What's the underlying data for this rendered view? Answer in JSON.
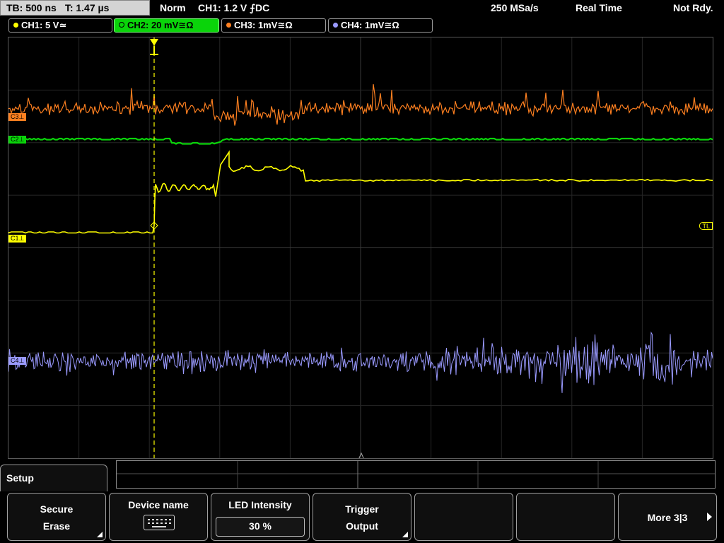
{
  "status_bar": {
    "timebase": "TB: 500 ns",
    "trigger_time": "T: 1.47 µs",
    "trigger_mode": "Norm",
    "trigger_info": "CH1: 1.2 V ⨍DC",
    "sample_rate": "250 MSa/s",
    "acq_mode": "Real Time",
    "state": "Not Rdy."
  },
  "channels": [
    {
      "label": "CH1: 5 V≃",
      "color": "#ffff00"
    },
    {
      "label": "CH2: 20 mV≅Ω",
      "color": "#0ad40a",
      "active": true
    },
    {
      "label": "CH3: 1mV≅Ω",
      "color": "#ff8020"
    },
    {
      "label": "CH4: 1mV≅Ω",
      "color": "#9a9aff"
    }
  ],
  "markers": {
    "c3": "C3⊥",
    "c2": "C2⊥",
    "c1": "C1⊥",
    "c4": "C4⊥",
    "trigger_level": "TL"
  },
  "menu": {
    "title": "Setup",
    "softkeys": [
      {
        "line1": "Secure",
        "line2": "Erase"
      },
      {
        "line1": "Device name",
        "icon": "keyboard-icon"
      },
      {
        "line1": "LED Intensity",
        "value": "30 %"
      },
      {
        "line1": "Trigger",
        "line2": "Output"
      },
      {
        "line1": ""
      },
      {
        "line1": ""
      },
      {
        "line1": "More 3|3"
      }
    ]
  }
}
